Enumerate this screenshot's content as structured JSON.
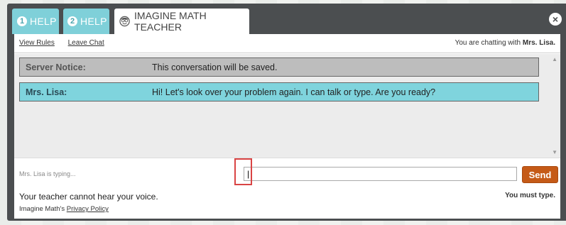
{
  "tabs": [
    {
      "number": "1",
      "label": "HELP"
    },
    {
      "number": "2",
      "label": "HELP"
    },
    {
      "label": "IMAGINE MATH TEACHER"
    }
  ],
  "close_label": "×",
  "links": {
    "view_rules": "View Rules",
    "leave_chat": "Leave Chat"
  },
  "chatting": {
    "prefix": "You are chatting with",
    "name": "Mrs. Lisa."
  },
  "messages": [
    {
      "sender": "Server Notice:",
      "text": "This conversation will be saved."
    },
    {
      "sender": "Mrs. Lisa:",
      "text": "Hi! Let's look over your problem again. I can talk or type. Are you ready?"
    }
  ],
  "typing_status": "Mrs. Lisa is typing...",
  "input": {
    "value": "|",
    "placeholder": ""
  },
  "send_label": "Send",
  "voice_note": "Your teacher cannot hear your voice.",
  "must_type": "You must type.",
  "privacy": {
    "prefix": "Imagine Math's",
    "link": "Privacy Policy"
  },
  "colors": {
    "tab": "#7fd0d9",
    "lisa_msg": "#7fd4dd",
    "server_msg": "#bdbdbd",
    "send": "#c55a17",
    "window": "#4b4e50"
  },
  "icons": {
    "tab3": "teacher-face-icon",
    "close": "close-icon"
  }
}
